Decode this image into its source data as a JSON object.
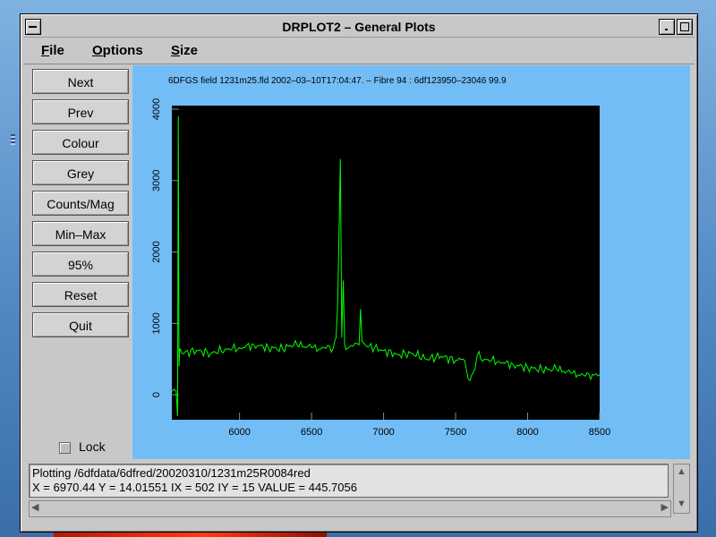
{
  "window": {
    "title": "DRPLOT2 – General Plots"
  },
  "menu": [
    "File",
    "Options",
    "Size"
  ],
  "buttons": [
    "Next",
    "Prev",
    "Colour",
    "Grey",
    "Counts/Mag",
    "Min–Max",
    "95%",
    "Reset",
    "Quit"
  ],
  "lock_label": "Lock",
  "status": {
    "line1": "Plotting /6dfdata/6dfred/20020310/1231m25R0084red",
    "line2": " X = 6970.44  Y = 14.01551  IX = 502  IY = 15  VALUE = 445.7056"
  },
  "colors": {
    "plot_bg": "#000000",
    "panel_bg": "#73bdf7",
    "trace": "#00ff00"
  },
  "chart_data": {
    "type": "line",
    "title": "6DFGS field 1231m25.fld 2002–03–10T17:04:47. – Fibre 94   : 6df123950–23046   99.9",
    "xlabel": "",
    "ylabel": "",
    "xlim": [
      5530,
      8500
    ],
    "ylim": [
      -350,
      4050
    ],
    "xticks": [
      6000,
      6500,
      7000,
      7500,
      8000,
      8500
    ],
    "yticks": [
      0,
      1000,
      2000,
      3000,
      4000
    ],
    "series": [
      {
        "x": [
          5530,
          5560,
          5570,
          5575,
          5580,
          5585,
          5600,
          5700,
          5800,
          5900,
          6000,
          6100,
          6200,
          6300,
          6350,
          6400,
          6500,
          6550,
          6600,
          6650,
          6670,
          6680,
          6690,
          6700,
          6710,
          6720,
          6730,
          6750,
          6800,
          6830,
          6840,
          6850,
          6870,
          6900,
          7000,
          7100,
          7200,
          7300,
          7400,
          7500,
          7550,
          7600,
          7620,
          7650,
          7700,
          7800,
          7900,
          8000,
          8100,
          8200,
          8300,
          8400,
          8500
        ],
        "y": [
          50,
          50,
          -300,
          3900,
          400,
          650,
          580,
          620,
          580,
          640,
          660,
          700,
          660,
          640,
          690,
          700,
          660,
          640,
          650,
          650,
          800,
          1200,
          2200,
          3300,
          800,
          1600,
          700,
          650,
          720,
          700,
          1200,
          750,
          700,
          680,
          620,
          560,
          580,
          500,
          540,
          480,
          500,
          200,
          300,
          550,
          500,
          470,
          420,
          380,
          350,
          360,
          300,
          260,
          280
        ]
      }
    ]
  }
}
